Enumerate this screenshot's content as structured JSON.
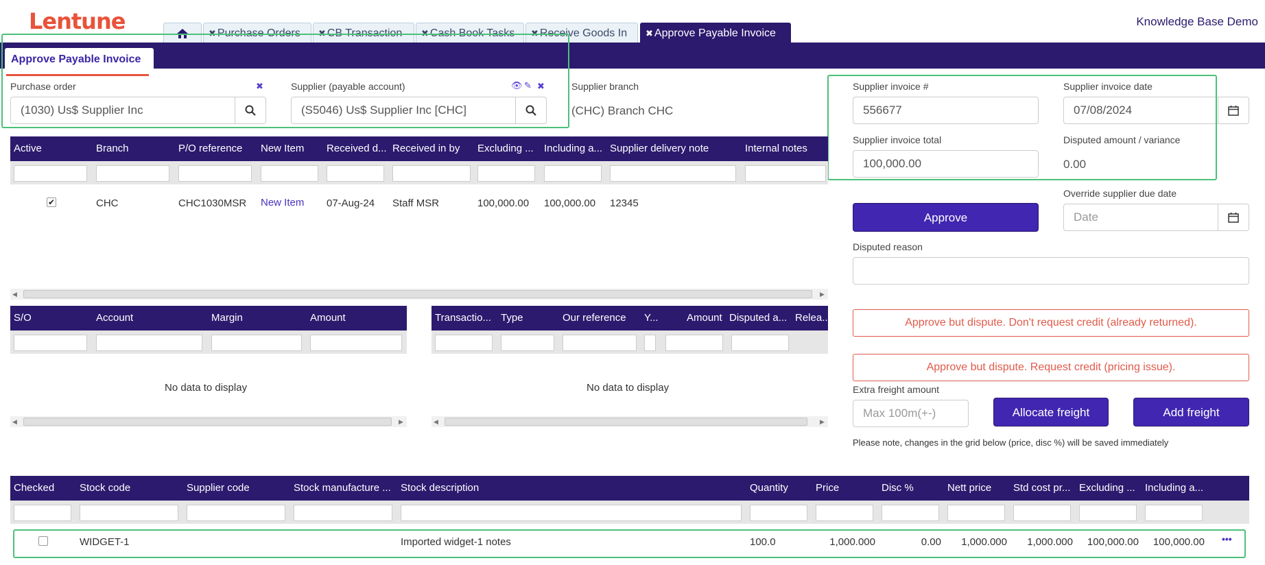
{
  "app": {
    "logo": "Lentune",
    "user": "Knowledge Base Demo"
  },
  "tabs": [
    {
      "label": "Purchase Orders"
    },
    {
      "label": "CB Transaction"
    },
    {
      "label": "Cash Book Tasks"
    },
    {
      "label": "Receive Goods In"
    },
    {
      "label": "Approve Payable Invoice"
    }
  ],
  "subtab": "Approve Payable Invoice",
  "form": {
    "purchase_order_label": "Purchase order",
    "purchase_order_value": "(1030) Us$ Supplier Inc",
    "supplier_label": "Supplier (payable account)",
    "supplier_value": "(S5046) Us$ Supplier Inc [CHC]",
    "branch_label": "Supplier branch",
    "branch_value": "(CHC) Branch CHC",
    "invoice_no_label": "Supplier invoice #",
    "invoice_no_value": "556677",
    "invoice_date_label": "Supplier invoice date",
    "invoice_date_value": "07/08/2024",
    "invoice_total_label": "Supplier invoice total",
    "invoice_total_value": "100,000.00",
    "disputed_label": "Disputed amount / variance",
    "disputed_value": "0.00",
    "override_due_label": "Override supplier due date",
    "override_due_placeholder": "Date",
    "disputed_reason_label": "Disputed reason",
    "extra_freight_label": "Extra freight amount",
    "extra_freight_placeholder": "Max 100m(+-)",
    "note": "Please note, changes in the grid below (price, disc %) will be saved immediately"
  },
  "buttons": {
    "approve": "Approve",
    "dispute_no_credit": "Approve but dispute. Don't request credit (already returned).",
    "dispute_credit": "Approve but dispute. Request credit (pricing issue).",
    "allocate_freight": "Allocate freight",
    "add_freight": "Add freight"
  },
  "receipts_grid": {
    "headers": [
      "Active",
      "Branch",
      "P/O reference",
      "New Item",
      "Received d...",
      "Received in by",
      "Excluding ...",
      "Including a...",
      "Supplier delivery note",
      "Internal notes"
    ],
    "row": {
      "active": "✔",
      "branch": "CHC",
      "po_ref": "CHC1030MSR",
      "new_item": "New Item",
      "received_date": "07-Aug-24",
      "received_by": "Staff MSR",
      "excl": "100,000.00",
      "incl": "100,000.00",
      "delivery_note": "12345",
      "internal_notes": ""
    }
  },
  "so_grid": {
    "headers": [
      "S/O",
      "Account",
      "Margin",
      "Amount"
    ],
    "empty": "No data to display"
  },
  "trans_grid": {
    "headers": [
      "Transactio...",
      "Type",
      "Our reference",
      "Y...",
      "Amount",
      "Disputed a...",
      "Relea..."
    ],
    "empty": "No data to display"
  },
  "lines_grid": {
    "headers": [
      "Checked",
      "Stock code",
      "Supplier code",
      "Stock manufacture ...",
      "Stock description",
      "Quantity",
      "Price",
      "Disc %",
      "Nett price",
      "Std cost pr...",
      "Excluding ...",
      "Including a..."
    ],
    "row": {
      "stock_code": "WIDGET-1",
      "supplier_code": "",
      "manufacture": "",
      "description": "Imported widget-1 notes",
      "quantity": "100.0",
      "price": "1,000.000",
      "disc": "0.00",
      "nett": "1,000.000",
      "std_cost": "1,000.000",
      "excl": "100,000.00",
      "incl": "100,000.00",
      "more": "•••"
    }
  }
}
